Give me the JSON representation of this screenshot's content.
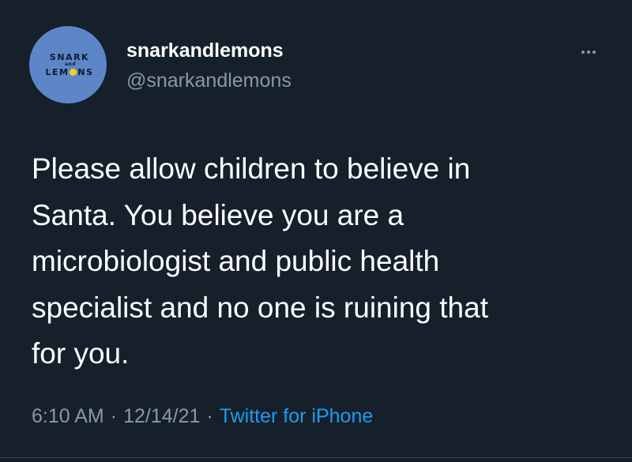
{
  "tweet": {
    "avatar": {
      "logo_top": "SNARK",
      "logo_and": "and",
      "logo_bottom_start": "LEM",
      "logo_bottom_end": "NS",
      "bg_color": "#5d86c9",
      "accent_color": "#f4d11a"
    },
    "display_name": "snarkandlemons",
    "handle": "@snarkandlemons",
    "more_icon": "more-horizontal-icon",
    "text": "Please allow children to believe in\nSanta. You believe you are a\nmicrobiologist and public health\nspecialist and no one is ruining that\nfor you.",
    "time": "6:10 AM",
    "date": "12/14/21",
    "separator": "·",
    "source": "Twitter for iPhone"
  },
  "colors": {
    "background": "#15202b",
    "secondary_text": "#8b98a5",
    "link": "#1d9bf0"
  }
}
